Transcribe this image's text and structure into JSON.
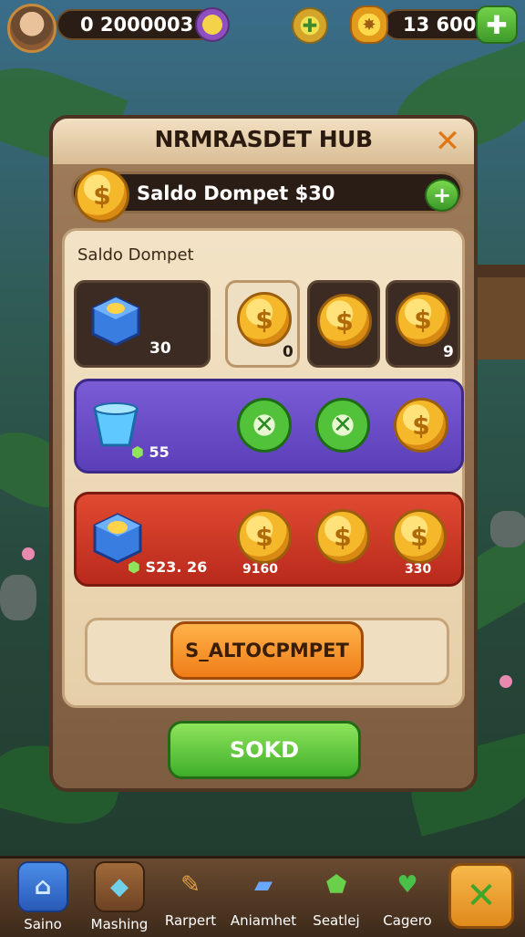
{
  "topbar": {
    "currency_left": "0 2000003",
    "currency_right": "13 600",
    "icons": {
      "avatar": "player-avatar",
      "gem": "gem-icon",
      "clover": "clover-icon",
      "badge": "sun-badge-icon",
      "plus": "plus-icon"
    }
  },
  "panel": {
    "title": "NRMRASDET HUB",
    "close_glyph": "✕",
    "wallet_label": "Saldo Dompet $30",
    "wallet_plus": "+",
    "inner_title": "Saldo Dompet"
  },
  "rows": {
    "row1": {
      "cube_label": "30",
      "coin1_label": "0",
      "coin3_label": "9"
    },
    "row2": {
      "cube_label": "55"
    },
    "row3": {
      "cube_label": "S23. 26",
      "coin1_label": "9160",
      "coin3_label": "330"
    }
  },
  "buttons": {
    "orange": "S_ALTOCPMPET",
    "green": "SOKD"
  },
  "nav": [
    {
      "label": "Saino",
      "icon": "home-icon"
    },
    {
      "label": "Mashing",
      "icon": "map-icon"
    },
    {
      "label": "Rarpert",
      "icon": "scroll-icon"
    },
    {
      "label": "Aniamhet",
      "icon": "card-icon"
    },
    {
      "label": "Seatlej",
      "icon": "shield-icon"
    },
    {
      "label": "Cagero",
      "icon": "heart-icon"
    }
  ],
  "colors": {
    "accent_orange": "#f07d18",
    "accent_green": "#3fae2a",
    "row_purple": "#5b3fb8",
    "row_red": "#b92a1c"
  }
}
